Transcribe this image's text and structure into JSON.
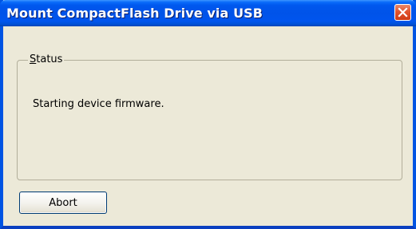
{
  "window": {
    "title": "Mount CompactFlash Drive via USB",
    "accent_color": "#0054e3",
    "close_icon": "close-icon"
  },
  "status_group": {
    "legend_first": "S",
    "legend_rest": "tatus",
    "message": "Starting device firmware."
  },
  "buttons": {
    "abort_label": "Abort"
  }
}
